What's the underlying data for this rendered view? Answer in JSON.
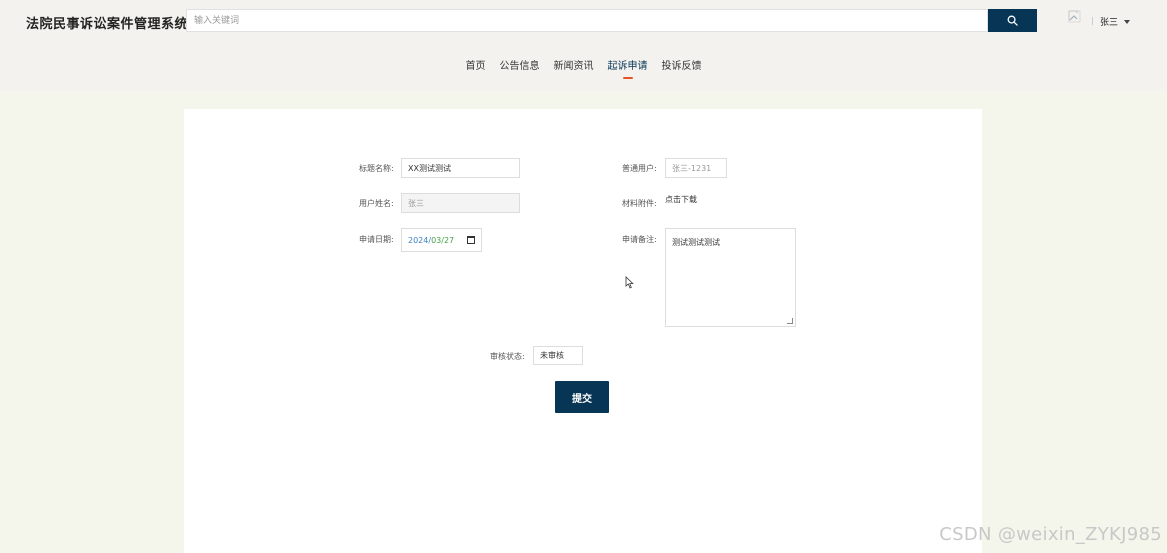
{
  "app": {
    "title": "法院民事诉讼案件管理系统"
  },
  "search": {
    "placeholder": "输入关键词",
    "icon": "search-icon"
  },
  "user": {
    "name": "张三"
  },
  "nav": {
    "items": [
      {
        "label": "首页",
        "active": false
      },
      {
        "label": "公告信息",
        "active": false
      },
      {
        "label": "新闻资讯",
        "active": false
      },
      {
        "label": "起诉申请",
        "active": true
      },
      {
        "label": "投诉反馈",
        "active": false
      }
    ],
    "accent": "#e8542a"
  },
  "form": {
    "title_label": "标题名称:",
    "title_value": "XX测试测试",
    "user_label": "普通用户:",
    "user_value": "张三-1231",
    "name_label": "用户姓名:",
    "name_value": "张三",
    "attach_label": "材料附件:",
    "attach_link": "点击下载",
    "date_label": "申请日期:",
    "date_year": "2024",
    "date_month": "03",
    "date_day": "27",
    "note_label": "申请备注:",
    "note_value": "测试测试测试",
    "status_label": "审核状态:",
    "status_value": "未审核",
    "submit_label": "提交"
  },
  "colors": {
    "primary": "#063556",
    "background": "#f4f6ec",
    "header": "#f3f2ee"
  },
  "watermark": "CSDN @weixin_ZYKJ985"
}
